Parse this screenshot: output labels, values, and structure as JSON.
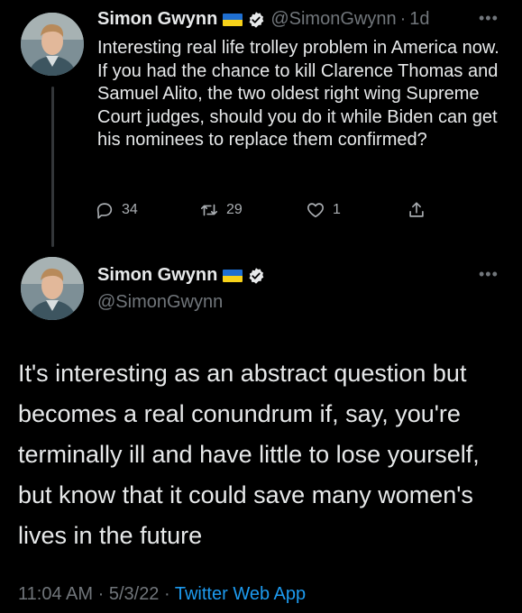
{
  "tweet1": {
    "author_name": "Simon Gwynn",
    "handle": "@SimonGwynn",
    "time": "1d",
    "text": "Interesting real life trolley problem in America now. If you had the chance to kill Clarence Thomas and Samuel Alito, the two oldest right wing Supreme Court judges, should you do it while Biden can get his nominees to replace them confirmed?",
    "reply_count": "34",
    "retweet_count": "29",
    "like_count": "1",
    "icons": [
      "verified-icon",
      "ukraine-flag-icon",
      "more-icon",
      "reply-icon",
      "retweet-icon",
      "like-icon",
      "share-icon"
    ]
  },
  "tweet2": {
    "author_name": "Simon Gwynn",
    "handle": "@SimonGwynn",
    "text": "It's interesting as an abstract question but becomes a real conundrum if, say, you're terminally ill and have little to lose yourself, but know that it could save many women's lives in the future",
    "time": "11:04 AM",
    "date": "5/3/22",
    "source": "Twitter Web App"
  },
  "separator": "·",
  "colors": {
    "background": "#000000",
    "text": "#e7e9ea",
    "muted": "#71767b",
    "accent": "#1d9bf0",
    "flag_blue": "#1f6fd1",
    "flag_yellow": "#f7d21a"
  }
}
